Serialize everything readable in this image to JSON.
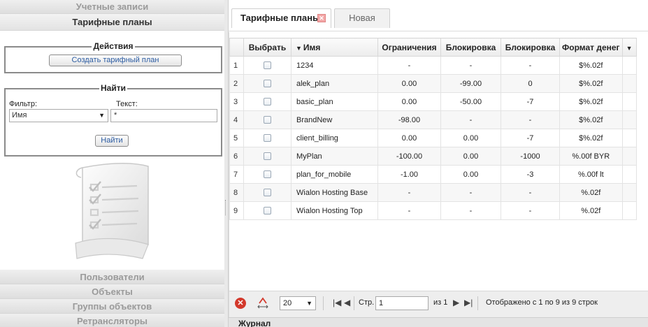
{
  "sidebar": {
    "top_sections": [
      "Учетные записи",
      "Тарифные планы"
    ],
    "actions": {
      "legend": "Действия",
      "create_button": "Создать тарифный план"
    },
    "find": {
      "legend": "Найти",
      "filter_label": "Фильтр:",
      "text_label": "Текст:",
      "filter_value": "Имя",
      "text_value": "*",
      "find_button": "Найти"
    },
    "bottom_sections": [
      "Пользователи",
      "Объекты",
      "Группы объектов",
      "Ретрансляторы"
    ]
  },
  "tabs": [
    {
      "label": "Тарифные планы",
      "active": true
    },
    {
      "label": "Новая",
      "active": false
    }
  ],
  "table": {
    "columns": [
      "Выбрать",
      "Имя",
      "Ограничения",
      "Блокировка",
      "Блокировка",
      "Формат денег"
    ],
    "rows": [
      {
        "num": "1",
        "name": "1234",
        "limits": "-",
        "block1": "-",
        "block2": "-",
        "money": "$%.02f"
      },
      {
        "num": "2",
        "name": "alek_plan",
        "limits": "0.00",
        "block1": "-99.00",
        "block2": "0",
        "money": "$%.02f"
      },
      {
        "num": "3",
        "name": "basic_plan",
        "limits": "0.00",
        "block1": "-50.00",
        "block2": "-7",
        "money": "$%.02f"
      },
      {
        "num": "4",
        "name": "BrandNew",
        "limits": "-98.00",
        "block1": "-",
        "block2": "-",
        "money": "$%.02f"
      },
      {
        "num": "5",
        "name": "client_billing",
        "limits": "0.00",
        "block1": "0.00",
        "block2": "-7",
        "money": "$%.02f"
      },
      {
        "num": "6",
        "name": "MyPlan",
        "limits": "-100.00",
        "block1": "0.00",
        "block2": "-1000",
        "money": "%.00f BYR"
      },
      {
        "num": "7",
        "name": "plan_for_mobile",
        "limits": "-1.00",
        "block1": "0.00",
        "block2": "-3",
        "money": "%.00f lt"
      },
      {
        "num": "8",
        "name": "Wialon Hosting Base",
        "limits": "-",
        "block1": "-",
        "block2": "-",
        "money": "%.02f"
      },
      {
        "num": "9",
        "name": "Wialon Hosting Top",
        "limits": "-",
        "block1": "-",
        "block2": "-",
        "money": "%.02f"
      }
    ]
  },
  "pager": {
    "page_size": "20",
    "page_label": "Стр.",
    "page_value": "1",
    "of_label": "из 1",
    "status": "Отображено с 1 по 9 из 9 строк"
  },
  "journal": {
    "label": "Журнал"
  },
  "colors": {
    "clear_icon": "#d3392c",
    "tab_close": "#f3a7a7"
  }
}
